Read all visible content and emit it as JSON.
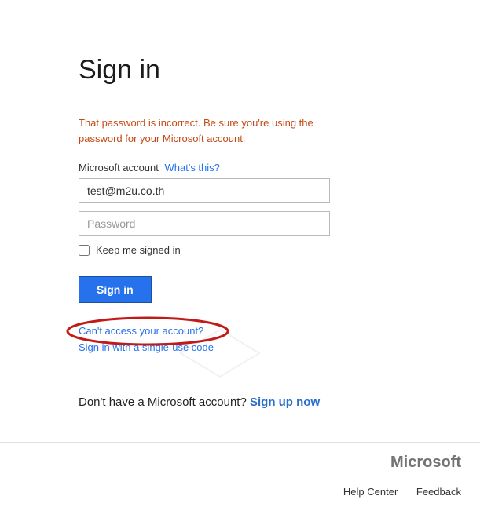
{
  "heading": "Sign in",
  "error_message": "That password is incorrect. Be sure you're using the password for your Microsoft account.",
  "account_label": "Microsoft account",
  "whats_this": "What's this?",
  "email_value": "test@m2u.co.th",
  "password_placeholder": "Password",
  "keep_signed_label": "Keep me signed in",
  "signin_button": "Sign in",
  "cant_access": "Can't access your account?",
  "single_use": "Sign in with a single-use code",
  "no_account_text": "Don't have a Microsoft account? ",
  "signup_link": "Sign up now",
  "brand": "Microsoft",
  "footer": {
    "help": "Help Center",
    "feedback": "Feedback"
  }
}
